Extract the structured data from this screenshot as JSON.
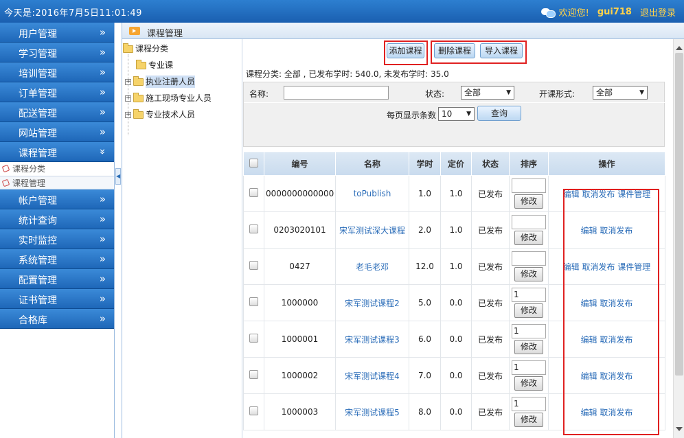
{
  "topbar": {
    "date": "今天是:2016年7月5日11:01:49",
    "welcome": "欢迎您!",
    "username": "gui718",
    "logout": "退出登录"
  },
  "sidebar": {
    "items_top": [
      "用户管理",
      "学习管理",
      "培训管理",
      "订单管理",
      "配送管理",
      "网站管理",
      "课程管理"
    ],
    "chev": "»",
    "chev_open": "»",
    "sub": [
      "课程分类",
      "课程管理"
    ],
    "items_bottom": [
      "帐户管理",
      "统计查询",
      "实时监控",
      "系统管理",
      "配置管理",
      "证书管理",
      "合格库"
    ]
  },
  "breadcrumb": "课程管理",
  "tree": {
    "root": "课程分类",
    "nodes": [
      "专业课",
      "执业注册人员",
      "施工现场专业人员",
      "专业技术人员"
    ]
  },
  "toolbar": {
    "add": "添加课程",
    "delete": "删除课程",
    "import": "导入课程"
  },
  "summary": "课程分类: 全部 , 已发布学时: 540.0, 未发布学时: 35.0",
  "filters": {
    "name_label": "名称:",
    "name_value": "",
    "status_label": "状态:",
    "status_value": "全部",
    "mode_label": "开课形式:",
    "mode_value": "全部",
    "pagesize_label": "每页显示条数",
    "pagesize_value": "10",
    "query": "查询"
  },
  "table": {
    "headers": [
      "编号",
      "名称",
      "学时",
      "定价",
      "状态",
      "排序",
      "操作"
    ],
    "rows": [
      {
        "id": "0000000000000",
        "name": "toPublish",
        "hours": "1.0",
        "price": "1.0",
        "status": "已发布",
        "sort": "",
        "ops": "编辑 取消发布 课件管理"
      },
      {
        "id": "0203020101",
        "name": "宋军测试深大课程",
        "hours": "2.0",
        "price": "1.0",
        "status": "已发布",
        "sort": "",
        "ops": "编辑 取消发布"
      },
      {
        "id": "0427",
        "name": "老毛老邓",
        "hours": "12.0",
        "price": "1.0",
        "status": "已发布",
        "sort": "",
        "ops": "编辑 取消发布 课件管理"
      },
      {
        "id": "1000000",
        "name": "宋军测试课程2",
        "hours": "5.0",
        "price": "0.0",
        "status": "已发布",
        "sort": "1",
        "ops": "编辑 取消发布"
      },
      {
        "id": "1000001",
        "name": "宋军测试课程3",
        "hours": "6.0",
        "price": "0.0",
        "status": "已发布",
        "sort": "1",
        "ops": "编辑 取消发布"
      },
      {
        "id": "1000002",
        "name": "宋军测试课程4",
        "hours": "7.0",
        "price": "0.0",
        "status": "已发布",
        "sort": "1",
        "ops": "编辑 取消发布"
      },
      {
        "id": "1000003",
        "name": "宋军测试课程5",
        "hours": "8.0",
        "price": "0.0",
        "status": "已发布",
        "sort": "1",
        "ops": "编辑 取消发布"
      }
    ],
    "modify": "修改"
  }
}
